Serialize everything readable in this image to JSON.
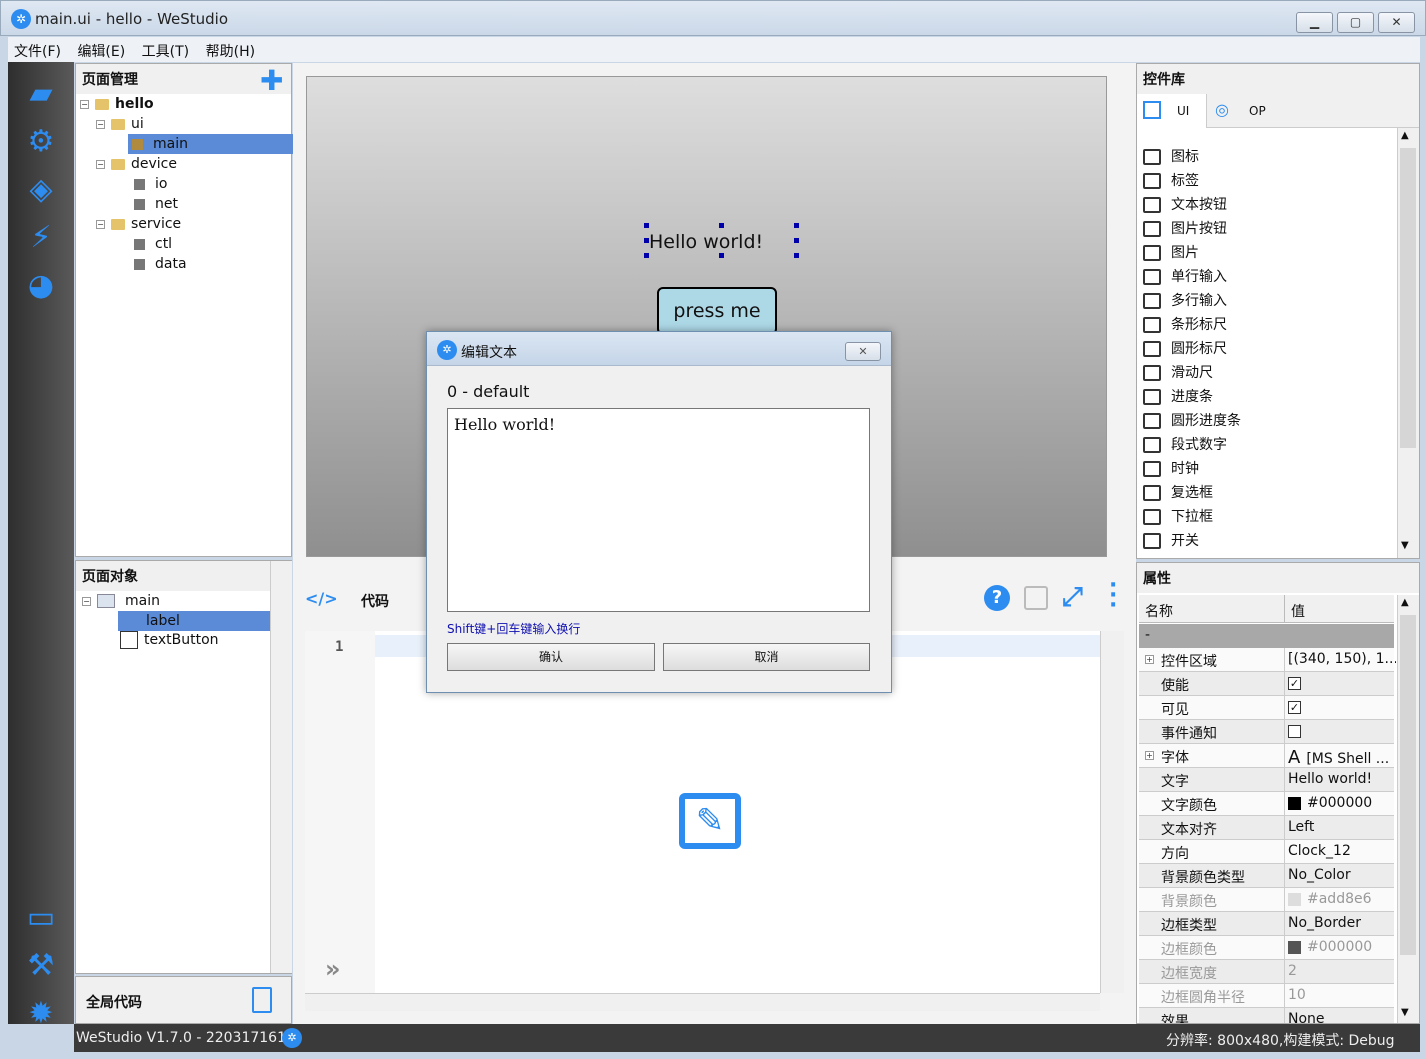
{
  "window": {
    "title": "main.ui - hello - WeStudio",
    "min": "▁",
    "max": "▢",
    "close": "✕"
  },
  "menu": [
    "文件(F)",
    "编辑(E)",
    "工具(T)",
    "帮助(H)"
  ],
  "page_manager": {
    "title": "页面管理",
    "tree": [
      {
        "label": "hello",
        "level": 0,
        "type": "folder",
        "bold": true
      },
      {
        "label": "ui",
        "level": 1,
        "type": "folder"
      },
      {
        "label": "main",
        "level": 2,
        "type": "page",
        "selected": true
      },
      {
        "label": "device",
        "level": 1,
        "type": "folder"
      },
      {
        "label": "io",
        "level": 2,
        "type": "file"
      },
      {
        "label": "net",
        "level": 2,
        "type": "file"
      },
      {
        "label": "service",
        "level": 1,
        "type": "folder"
      },
      {
        "label": "ctl",
        "level": 2,
        "type": "file"
      },
      {
        "label": "data",
        "level": 2,
        "type": "file"
      }
    ]
  },
  "page_objects": {
    "title": "页面对象",
    "tree": [
      {
        "label": "main",
        "level": 0
      },
      {
        "label": "label",
        "level": 1,
        "selected": true
      },
      {
        "label": "textButton",
        "level": 1
      }
    ]
  },
  "global_code": "全局代码",
  "canvas": {
    "label_text": "Hello world!",
    "button_text": "press me"
  },
  "code": {
    "tab": "代码",
    "line": "1"
  },
  "dialog": {
    "title": "编辑文本",
    "lang": "0 - default",
    "text": "Hello world!",
    "hint": "Shift键+回车键输入换行",
    "ok": "确认",
    "cancel": "取消",
    "close": "✕"
  },
  "controls": {
    "title": "控件库",
    "tab_ui": "UI",
    "tab_op": "OP",
    "items": [
      "图标",
      "标签",
      "文本按钮",
      "图片按钮",
      "图片",
      "单行输入",
      "多行输入",
      "条形标尺",
      "圆形标尺",
      "滑动尺",
      "进度条",
      "圆形进度条",
      "段式数字",
      "时钟",
      "复选框",
      "下拉框",
      "开关"
    ]
  },
  "properties": {
    "title": "属性",
    "col_name": "名称",
    "col_value": "值",
    "group": "-",
    "rows": [
      {
        "name": "控件区域",
        "value": "[(340, 150), 1...",
        "expand": true
      },
      {
        "name": "使能",
        "value": "✓",
        "check": true
      },
      {
        "name": "可见",
        "value": "✓",
        "check": true
      },
      {
        "name": "事件通知",
        "value": "",
        "check": true
      },
      {
        "name": "字体",
        "value": "[MS Shell ...",
        "expand": true,
        "font": "A"
      },
      {
        "name": "文字",
        "value": "Hello world!"
      },
      {
        "name": "文字颜色",
        "value": "#000000",
        "swatch": "#000000"
      },
      {
        "name": "文本对齐",
        "value": "Left"
      },
      {
        "name": "方向",
        "value": "Clock_12"
      },
      {
        "name": "背景颜色类型",
        "value": "No_Color"
      },
      {
        "name": "背景颜色",
        "value": "#add8e6",
        "swatch": "#dddddd",
        "disabled": true
      },
      {
        "name": "边框类型",
        "value": "No_Border"
      },
      {
        "name": "边框颜色",
        "value": "#000000",
        "swatch": "#555555",
        "disabled": true
      },
      {
        "name": "边框宽度",
        "value": "2",
        "disabled": true
      },
      {
        "name": "边框圆角半径",
        "value": "10",
        "disabled": true
      },
      {
        "name": "效果",
        "value": "None"
      }
    ]
  },
  "status": {
    "left": "WeStudio V1.7.0 - 2203171613",
    "right": "分辨率: 800x480,构建模式: Debug"
  },
  "colors": {
    "accent": "#2d8cf0",
    "selection": "#5b8bd6"
  }
}
